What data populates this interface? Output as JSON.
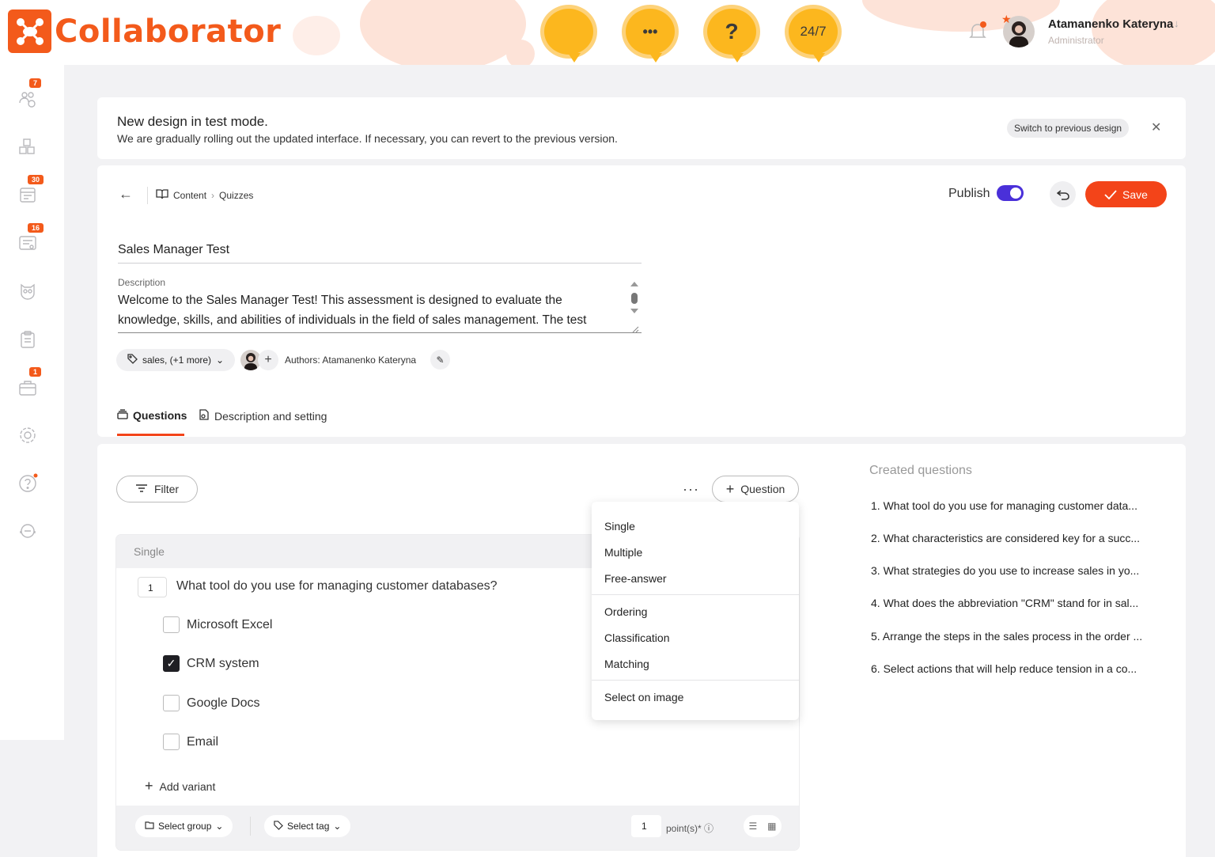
{
  "app": {
    "name": "Collaborator"
  },
  "header": {
    "support_buttons": [
      "",
      "•••",
      "?",
      "24/7"
    ],
    "user": {
      "name": "Atamanenko Kateryna",
      "role": "Administrator"
    }
  },
  "sidebar": {
    "items": [
      {
        "icon": "people-gear-icon",
        "badge": "7"
      },
      {
        "icon": "abc-blocks-icon",
        "badge": ""
      },
      {
        "icon": "calendar-icon",
        "badge": "30"
      },
      {
        "icon": "certificate-icon",
        "badge": "16"
      },
      {
        "icon": "owl-icon",
        "badge": ""
      },
      {
        "icon": "clipboard-icon",
        "badge": ""
      },
      {
        "icon": "briefcase-icon",
        "badge": "1"
      },
      {
        "icon": "gear-icon",
        "badge": ""
      },
      {
        "icon": "help-icon",
        "badge": ""
      },
      {
        "icon": "support-icon",
        "badge": ""
      }
    ]
  },
  "banner": {
    "title": "New design in test mode.",
    "text": "We are gradually rolling out the updated interface. If necessary, you can revert to the previous version.",
    "switch_label": "Switch to previous design"
  },
  "editor": {
    "breadcrumb": [
      "Content",
      "Quizzes"
    ],
    "publish_label": "Publish",
    "publish_on": true,
    "save_label": "Save",
    "title": "Sales Manager Test",
    "description_label": "Description",
    "description": "Welcome to the Sales Manager Test! This assessment is designed to evaluate the knowledge, skills, and abilities of individuals in the field of sales management. The test",
    "tags": "sales, (+1 more)",
    "authors": "Authors: Atamanenko Kateryna",
    "tabs": [
      "Questions",
      "Description and setting"
    ]
  },
  "questions": {
    "filter_label": "Filter",
    "add_question_label": "Question",
    "type_menu": [
      "Single",
      "Multiple",
      "Free-answer",
      "Ordering",
      "Classification",
      "Matching",
      "Select on image"
    ],
    "card": {
      "type": "Single",
      "number": "1",
      "text": "What tool do you use for managing customer databases?",
      "variants": [
        {
          "label": "Microsoft Excel",
          "checked": false
        },
        {
          "label": "CRM system",
          "checked": true
        },
        {
          "label": "Google Docs",
          "checked": false
        },
        {
          "label": "Email",
          "checked": false
        }
      ],
      "add_variant_label": "Add variant",
      "select_group_label": "Select group",
      "select_tag_label": "Select tag",
      "points": "1",
      "points_label": "point(s)*"
    },
    "created_title": "Created questions",
    "created": [
      "1. What tool do you use for managing customer data...",
      "2. What characteristics are considered key for a succ...",
      "3. What strategies do you use to increase sales in yo...",
      "4. What does the abbreviation \"CRM\" stand for in sal...",
      "5. Arrange the steps in the sales process in the order ...",
      "6. Select actions that will help reduce tension in a co..."
    ]
  },
  "colors": {
    "brand": "#f35a1b",
    "save": "#f34419",
    "toggle": "#4a30d9",
    "support": "#fcb71e"
  }
}
